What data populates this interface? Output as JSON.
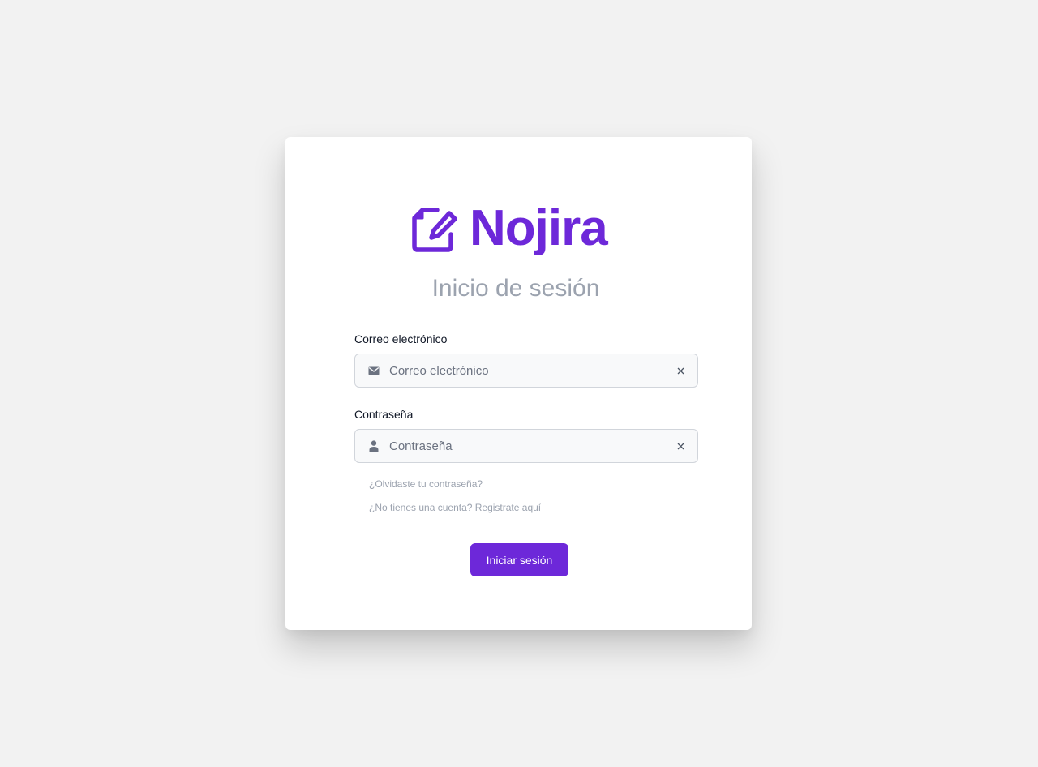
{
  "brand": {
    "name": "Nojira",
    "icon": "edit-document-icon",
    "color": "#6d28d9"
  },
  "title": "Inicio de sesión",
  "email": {
    "label": "Correo electrónico",
    "placeholder": "Correo electrónico",
    "value": "",
    "icon": "envelope-icon",
    "clear_icon": "close-icon"
  },
  "password": {
    "label": "Contraseña",
    "placeholder": "Contraseña",
    "value": "",
    "icon": "user-icon",
    "clear_icon": "close-icon"
  },
  "links": {
    "forgot": "¿Olvidaste tu contraseña?",
    "register": "¿No tienes una cuenta? Registrate aquí"
  },
  "submit_label": "Iniciar sesión",
  "colors": {
    "accent": "#6d28d9",
    "background": "#f2f2f2",
    "card": "#ffffff",
    "muted": "#9ca3af"
  }
}
